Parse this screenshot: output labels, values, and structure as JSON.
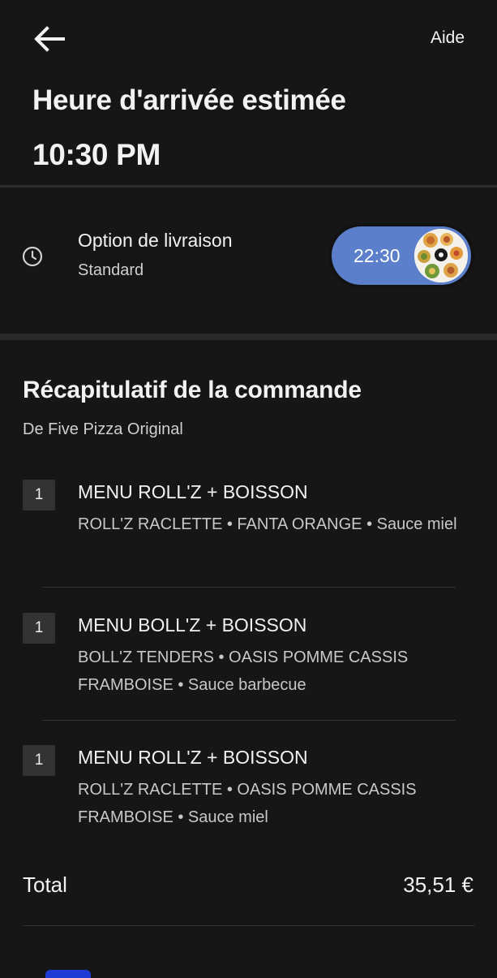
{
  "header": {
    "back_icon": "arrow-left-icon",
    "help_label": "Aide",
    "eta_title": "Heure d'arrivée estimée",
    "eta_time": "10:30 PM"
  },
  "delivery": {
    "icon": "clock-icon",
    "title": "Option de livraison",
    "subtitle": "Standard",
    "time_pill_label": "22:30",
    "pill_color": "#5b7fcb"
  },
  "summary": {
    "title": "Récapitulatif de la commande",
    "restaurant": "De Five Pizza Original",
    "items": [
      {
        "qty": "1",
        "name": "MENU ROLL'Z + BOISSON",
        "desc": "ROLL'Z RACLETTE • FANTA ORANGE • Sauce miel"
      },
      {
        "qty": "1",
        "name": "MENU BOLL'Z + BOISSON",
        "desc": "BOLL'Z TENDERS • OASIS POMME CASSIS FRAMBOISE • Sauce barbecue"
      },
      {
        "qty": "1",
        "name": "MENU ROLL'Z + BOISSON",
        "desc": "ROLL'Z RACLETTE • OASIS POMME CASSIS FRAMBOISE • Sauce miel"
      }
    ]
  },
  "total": {
    "label": "Total",
    "value": "35,51 €"
  },
  "colors": {
    "background": "#161616",
    "accent_blue": "#5b7fcb",
    "payment_blue": "#1f3bd6"
  }
}
